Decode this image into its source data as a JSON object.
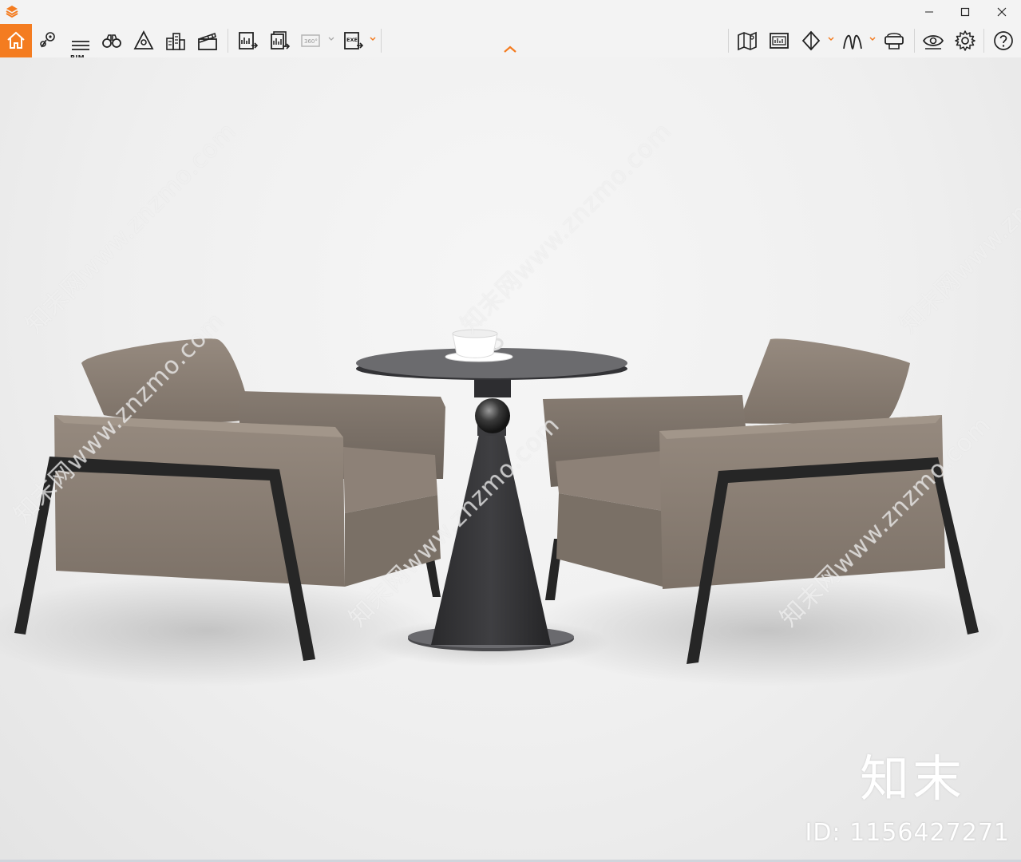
{
  "app": {
    "title": "",
    "accent_color": "#f47c20"
  },
  "window_controls": {
    "minimize": "minimize-icon",
    "maximize": "maximize-icon",
    "close": "close-icon"
  },
  "toolbar": {
    "bim_label": "BIM",
    "left_tools": [
      "home-icon",
      "location-pin-icon",
      "bim-list-icon",
      "binoculars-icon",
      "tripod-camera-icon",
      "buildings-icon",
      "clapperboard-icon",
      "export-image-icon",
      "export-batch-image-icon",
      "export-360-icon",
      "export-exe-icon"
    ],
    "right_tools": [
      "map-icon",
      "panel-icon",
      "material-icon",
      "terrain-icon",
      "vr-headset-icon",
      "view-eye-icon",
      "settings-gear-icon",
      "help-icon"
    ],
    "badge_360": "360°",
    "badge_exe": "EXE"
  },
  "viewport": {
    "scene": "two-armchairs-and-round-table",
    "watermark_text": "知末网www.znzmo.com",
    "brand_logo": "知末",
    "id_text": "ID: 1156427271"
  }
}
